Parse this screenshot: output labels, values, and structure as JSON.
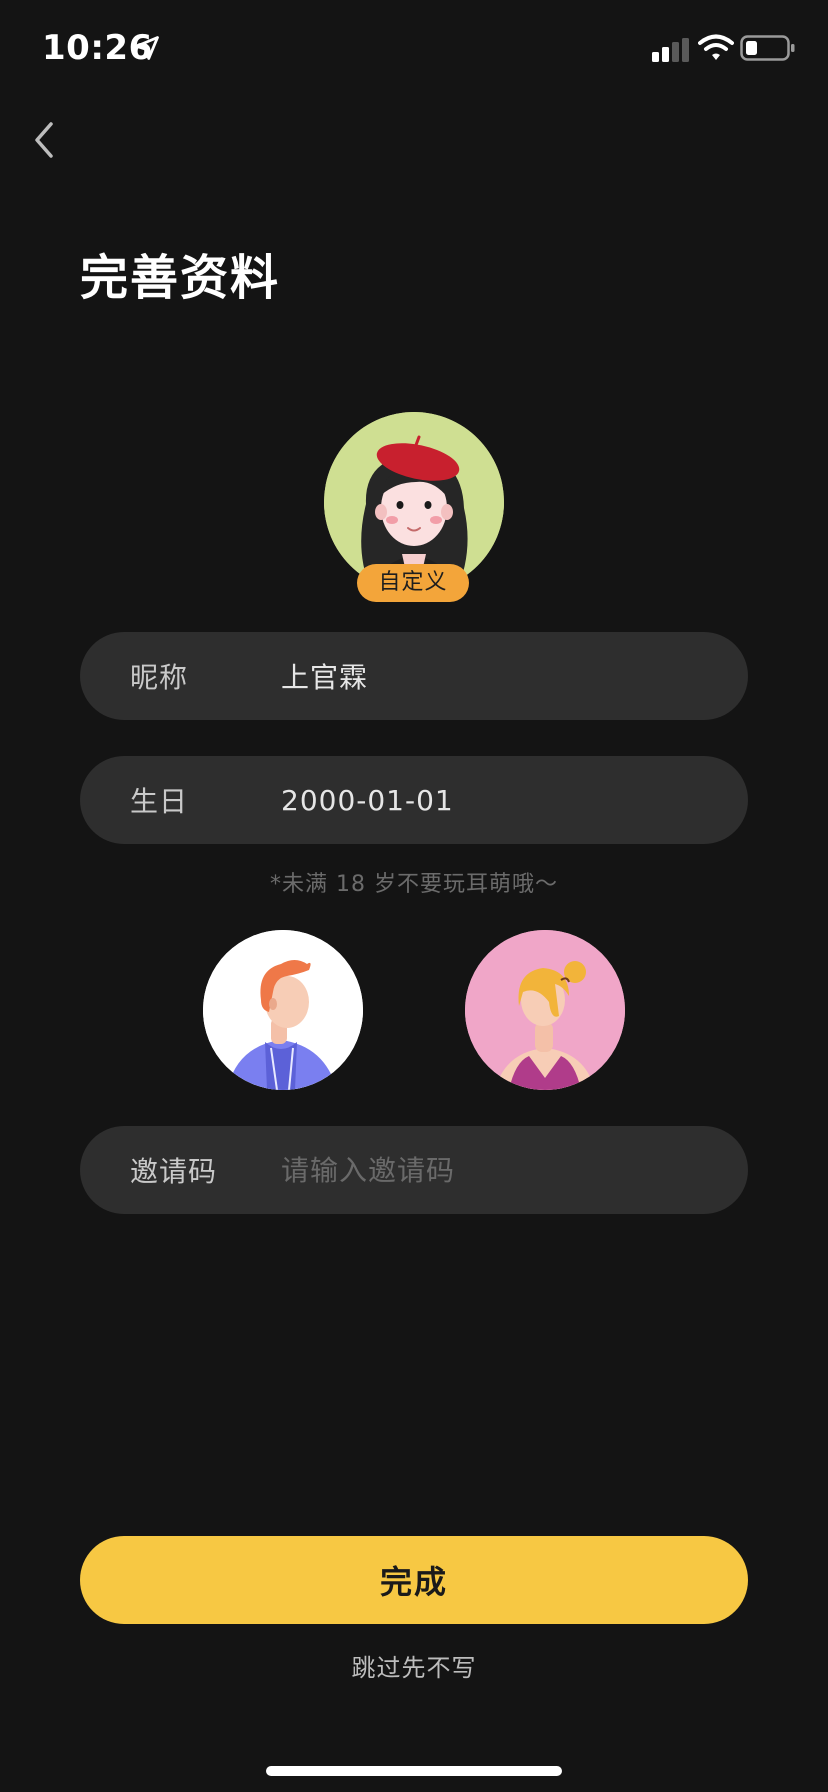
{
  "status_bar": {
    "time": "10:26",
    "icons": [
      "location-arrow-icon",
      "signal-icon",
      "wifi-icon",
      "battery-icon"
    ]
  },
  "header": {
    "back_icon": "chevron-left-icon",
    "title": "完善资料"
  },
  "avatar": {
    "badge_label": "自定义",
    "background_color": "#cfdf92"
  },
  "form": {
    "nickname": {
      "label": "昵称",
      "value": "上官霖"
    },
    "birthday": {
      "label": "生日",
      "value": "2000-01-01"
    },
    "age_hint": "*未满 18 岁不要玩耳萌哦～",
    "gender_options": [
      {
        "name": "male",
        "background_color": "#ffffff"
      },
      {
        "name": "female",
        "background_color": "#f0a6c8"
      }
    ],
    "invite_code": {
      "label": "邀请码",
      "value": "",
      "placeholder": "请输入邀请码"
    }
  },
  "actions": {
    "done_label": "完成",
    "skip_label": "跳过先不写"
  },
  "colors": {
    "background": "#141414",
    "field_background": "#2e2e2e",
    "accent": "#f7c843",
    "badge": "#f3a53a"
  }
}
